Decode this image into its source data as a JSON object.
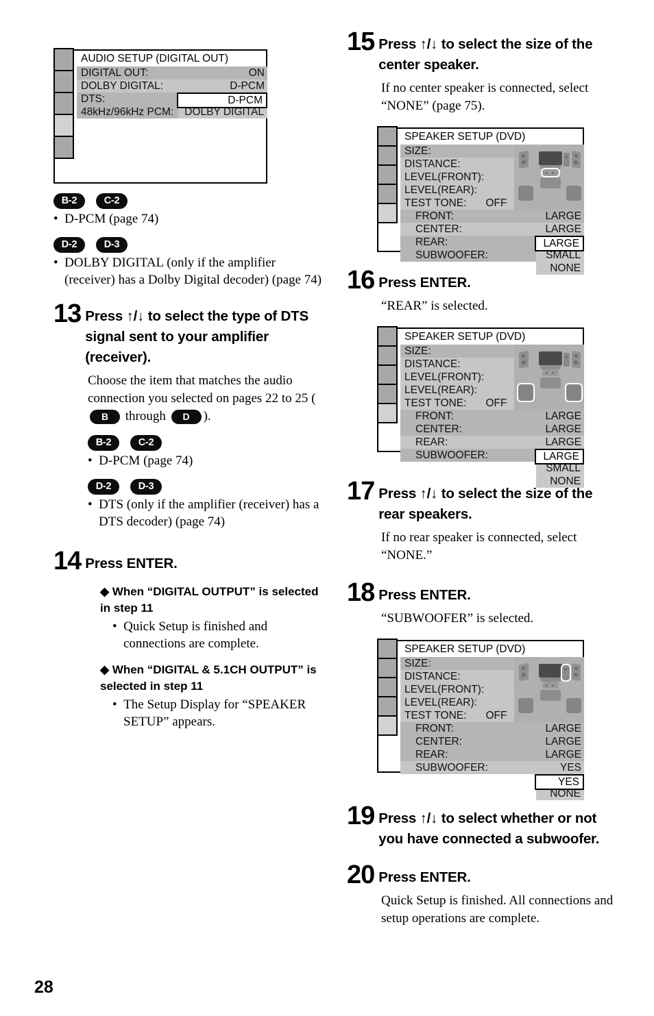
{
  "page": {
    "number": "28"
  },
  "left_column": {
    "audio_setup_screen": {
      "title": "AUDIO SETUP (DIGITAL OUT)",
      "tabs": [
        "tab-1",
        "tab-2",
        "tab-3",
        "tab-4",
        "tab-5"
      ],
      "selected_tab_index": 3,
      "rows": [
        {
          "label": "DIGITAL OUT:",
          "value": "ON"
        },
        {
          "label": "DOLBY DIGITAL:",
          "value": "D-PCM"
        },
        {
          "label": "DTS:",
          "value": ""
        },
        {
          "label": "48kHz/96kHz PCM:",
          "value": ""
        }
      ],
      "dropdown": {
        "selected": "D-PCM",
        "options": [
          "DOLBY DIGITAL"
        ]
      }
    },
    "note_group_1": {
      "badges": [
        "B-2",
        "C-2"
      ],
      "items": [
        "D-PCM (page 74)"
      ]
    },
    "note_group_2": {
      "badges": [
        "D-2",
        "D-3"
      ],
      "items": [
        "DOLBY DIGITAL (only if the amplifier (receiver) has a Dolby Digital decoder) (page 74)"
      ]
    },
    "step13": {
      "number": "13",
      "title": "Press ↑/↓ to select the type of DTS signal sent to your amplifier (receiver).",
      "body_before": "Choose the item that matches the audio connection you selected on pages 22 to 25 (",
      "badge_from": "B",
      "body_middle": " through ",
      "badge_to": "D",
      "body_after": ").",
      "note_group_1": {
        "badges": [
          "B-2",
          "C-2"
        ],
        "items": [
          "D-PCM (page 74)"
        ]
      },
      "note_group_2": {
        "badges": [
          "D-2",
          "D-3"
        ],
        "items": [
          "DTS (only if the amplifier (receiver) has a DTS decoder) (page 74)"
        ]
      }
    },
    "step14": {
      "number": "14",
      "title": "Press ENTER.",
      "sub1": {
        "heading": "◆ When “DIGITAL OUTPUT” is selected in step 11",
        "items": [
          "Quick Setup is finished and connections are complete."
        ]
      },
      "sub2": {
        "heading": "◆ When “DIGITAL & 5.1CH OUTPUT” is selected in step 11",
        "items": [
          "The Setup Display for “SPEAKER SETUP” appears."
        ]
      }
    }
  },
  "right_column": {
    "step15": {
      "number": "15",
      "title": "Press ↑/↓ to select the size of the center speaker.",
      "body": "If no center speaker is connected, select “NONE” (page 75)."
    },
    "speaker_screen_1": {
      "title": "SPEAKER SETUP (DVD)",
      "tabs": [
        "tab-1",
        "tab-2",
        "tab-3",
        "tab-4",
        "tab-5"
      ],
      "selected_tab_index": 4,
      "rows": [
        {
          "label": "SIZE:",
          "value": ""
        },
        {
          "label": "DISTANCE:",
          "value": ""
        },
        {
          "label": "LEVEL(FRONT):",
          "value": ""
        },
        {
          "label": "LEVEL(REAR):",
          "value": ""
        },
        {
          "label": "TEST TONE:",
          "value": "OFF"
        }
      ],
      "detail_rows": [
        {
          "label": "FRONT:",
          "value": "LARGE"
        },
        {
          "label": "CENTER:",
          "value": "LARGE"
        },
        {
          "label": "REAR:",
          "value": "LARGE"
        },
        {
          "label": "SUBWOOFER:",
          "value": ""
        }
      ],
      "dropdown": {
        "selected": "LARGE",
        "options": [
          "SMALL",
          "NONE"
        ]
      },
      "highlight": "center-speaker"
    },
    "step16": {
      "number": "16",
      "title": "Press ENTER.",
      "body": "“REAR” is selected."
    },
    "speaker_screen_2": {
      "title": "SPEAKER SETUP (DVD)",
      "tabs": [
        "tab-1",
        "tab-2",
        "tab-3",
        "tab-4",
        "tab-5"
      ],
      "selected_tab_index": 4,
      "rows": [
        {
          "label": "SIZE:",
          "value": ""
        },
        {
          "label": "DISTANCE:",
          "value": ""
        },
        {
          "label": "LEVEL(FRONT):",
          "value": ""
        },
        {
          "label": "LEVEL(REAR):",
          "value": ""
        },
        {
          "label": "TEST TONE:",
          "value": "OFF"
        }
      ],
      "detail_rows": [
        {
          "label": "FRONT:",
          "value": "LARGE"
        },
        {
          "label": "CENTER:",
          "value": "LARGE"
        },
        {
          "label": "REAR:",
          "value": "LARGE"
        },
        {
          "label": "SUBWOOFER:",
          "value": ""
        }
      ],
      "dropdown": {
        "selected": "LARGE",
        "options": [
          "SMALL",
          "NONE"
        ]
      },
      "highlight": "rear-speakers"
    },
    "step17": {
      "number": "17",
      "title": "Press ↑/↓ to select the size of the rear speakers.",
      "body": "If no rear speaker is connected, select “NONE.”"
    },
    "step18": {
      "number": "18",
      "title": "Press ENTER.",
      "body": "“SUBWOOFER” is selected."
    },
    "speaker_screen_3": {
      "title": "SPEAKER SETUP (DVD)",
      "tabs": [
        "tab-1",
        "tab-2",
        "tab-3",
        "tab-4",
        "tab-5"
      ],
      "selected_tab_index": 4,
      "rows": [
        {
          "label": "SIZE:",
          "value": ""
        },
        {
          "label": "DISTANCE:",
          "value": ""
        },
        {
          "label": "LEVEL(FRONT):",
          "value": ""
        },
        {
          "label": "LEVEL(REAR):",
          "value": ""
        },
        {
          "label": "TEST TONE:",
          "value": "OFF"
        }
      ],
      "detail_rows": [
        {
          "label": "FRONT:",
          "value": "LARGE"
        },
        {
          "label": "CENTER:",
          "value": "LARGE"
        },
        {
          "label": "REAR:",
          "value": "LARGE"
        },
        {
          "label": "SUBWOOFER:",
          "value": "YES"
        }
      ],
      "dropdown": {
        "selected": "YES",
        "options": [
          "NONE"
        ]
      },
      "highlight": "subwoofer"
    },
    "step19": {
      "number": "19",
      "title": "Press ↑/↓ to select whether or not you have connected a subwoofer."
    },
    "step20": {
      "number": "20",
      "title": "Press ENTER.",
      "body": "Quick Setup is finished. All connections and setup operations are complete."
    }
  }
}
